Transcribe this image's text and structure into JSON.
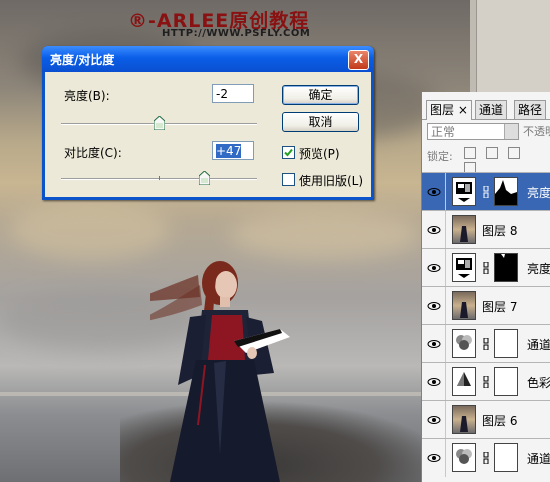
{
  "watermark": {
    "brand": "®-ARLEE原创教程",
    "url": "HTTP://WWW.PSFLY.COM"
  },
  "dialog": {
    "title": "亮度/对比度",
    "close_label": "X",
    "brightness_label": "亮度(B):",
    "brightness_value": "-2",
    "contrast_label": "对比度(C):",
    "contrast_value": "+47",
    "ok_label": "确定",
    "cancel_label": "取消",
    "preview_label": "预览(P)",
    "preview_checked": true,
    "legacy_label": "使用旧版(L)",
    "legacy_checked": false,
    "brightness_slider_fraction": 0.5,
    "contrast_slider_fraction": 0.73
  },
  "layers_panel": {
    "tabs": [
      "图层 ×",
      "通道",
      "路径"
    ],
    "blend_mode": "正常",
    "opacity_label": "不透明",
    "lock_label": "锁定:",
    "layers": [
      {
        "name": "亮度",
        "type": "adjustment",
        "selected": true
      },
      {
        "name": "图层 8",
        "type": "image",
        "selected": false
      },
      {
        "name": "亮度",
        "type": "adjustment",
        "selected": false
      },
      {
        "name": "图层 7",
        "type": "image",
        "selected": false
      },
      {
        "name": "通道",
        "type": "adjustment",
        "selected": false
      },
      {
        "name": "色彩",
        "type": "adjustment",
        "selected": false
      },
      {
        "name": "图层 6",
        "type": "image",
        "selected": false
      },
      {
        "name": "通道",
        "type": "adjustment",
        "selected": false
      }
    ]
  },
  "colors": {
    "title_blue": "#0a5ee7",
    "selected_layer": "#3a67b4",
    "watermark_red": "#8a1111"
  }
}
